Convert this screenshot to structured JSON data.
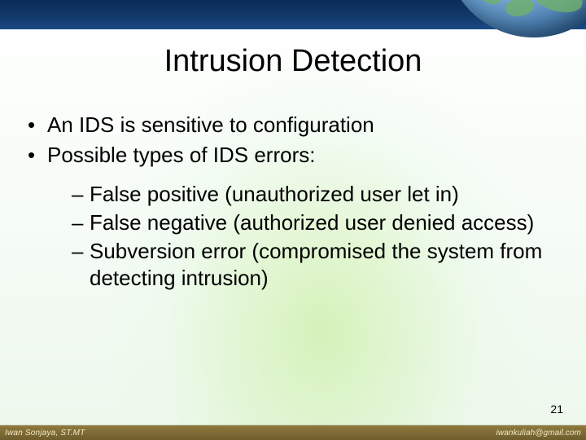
{
  "title": "Intrusion Detection",
  "bullets": {
    "b1": "An IDS is sensitive to configuration",
    "b2": "Possible types of IDS errors:",
    "sub1": "False positive (unauthorized user let in)",
    "sub2": "False negative (authorized user denied access)",
    "sub3": "Subversion error (compromised the system from detecting intrusion)"
  },
  "pagenum": "21",
  "footer": {
    "left": "Iwan Sonjaya, ST.MT",
    "right": "iwankuliah@gmail.com"
  }
}
